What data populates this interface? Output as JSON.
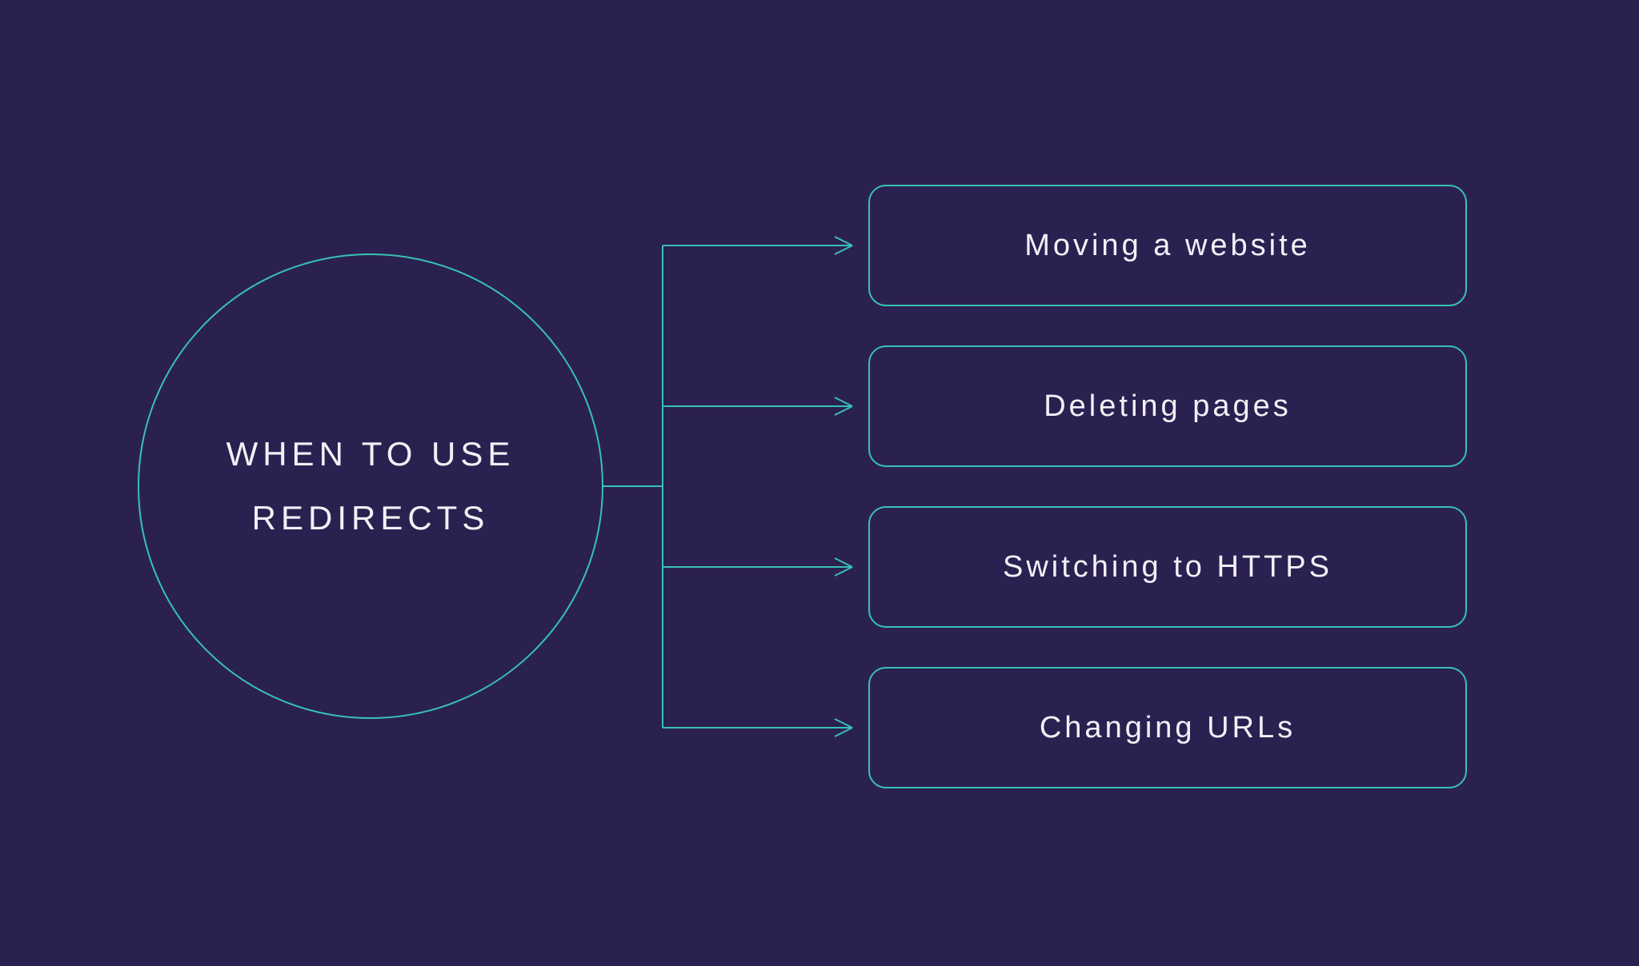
{
  "diagram": {
    "center": {
      "title": "WHEN TO USE REDIRECTS"
    },
    "items": [
      {
        "label": "Moving a website"
      },
      {
        "label": "Deleting pages"
      },
      {
        "label": "Switching to HTTPS"
      },
      {
        "label": "Changing URLs"
      }
    ],
    "colors": {
      "background": "#2b2150",
      "stroke": "#36c2b4",
      "text": "#f2f0f7"
    }
  }
}
